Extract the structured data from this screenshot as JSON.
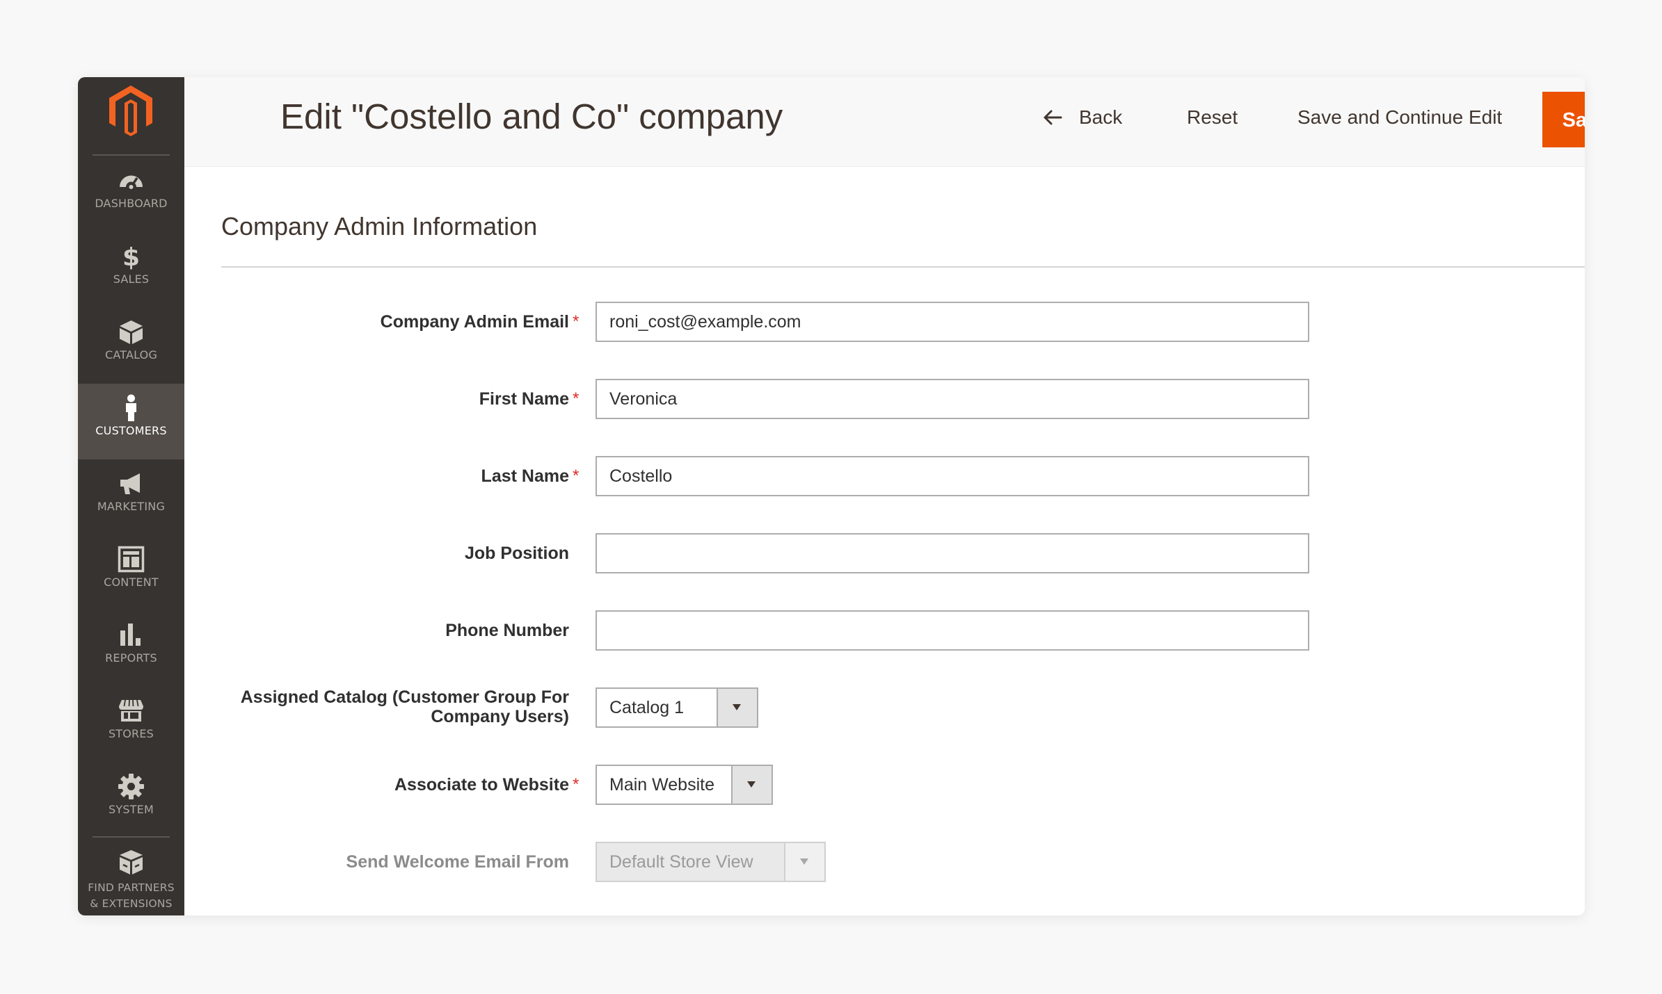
{
  "header": {
    "title": "Edit \"Costello and Co\" company",
    "back_label": "Back",
    "reset_label": "Reset",
    "save_continue_label": "Save and Continue Edit",
    "save_label": "Save"
  },
  "sidebar": {
    "items": [
      {
        "label": "DASHBOARD",
        "icon": "dashboard-icon"
      },
      {
        "label": "SALES",
        "icon": "dollar-icon"
      },
      {
        "label": "CATALOG",
        "icon": "box-icon"
      },
      {
        "label": "CUSTOMERS",
        "icon": "person-icon",
        "active": true
      },
      {
        "label": "MARKETING",
        "icon": "megaphone-icon"
      },
      {
        "label": "CONTENT",
        "icon": "layout-icon"
      },
      {
        "label": "REPORTS",
        "icon": "bar-chart-icon"
      },
      {
        "label": "STORES",
        "icon": "storefront-icon"
      },
      {
        "label": "SYSTEM",
        "icon": "gear-icon"
      },
      {
        "label_line1": "FIND PARTNERS",
        "label_line2": "& EXTENSIONS",
        "icon": "extensions-box-icon"
      }
    ]
  },
  "section": {
    "title": "Company Admin Information"
  },
  "form": {
    "admin_email": {
      "label": "Company Admin Email",
      "value": "roni_cost@example.com",
      "required": true
    },
    "first_name": {
      "label": "First Name",
      "value": "Veronica",
      "required": true
    },
    "last_name": {
      "label": "Last Name",
      "value": "Costello",
      "required": true
    },
    "job_position": {
      "label": "Job Position",
      "value": ""
    },
    "phone_number": {
      "label": "Phone Number",
      "value": ""
    },
    "assigned_catalog": {
      "label_line1": "Assigned Catalog (Customer Group For",
      "label_line2": "Company Users)",
      "value": "Catalog 1"
    },
    "website": {
      "label": "Associate to Website",
      "value": "Main Website",
      "required": true
    },
    "welcome_email": {
      "label": "Send Welcome Email From",
      "value": "Default Store View",
      "disabled": true
    }
  },
  "colors": {
    "sidebar_bg": "#373330",
    "sidebar_active": "#524d49",
    "brand_orange": "#eb5202",
    "required_red": "#e02b27"
  }
}
